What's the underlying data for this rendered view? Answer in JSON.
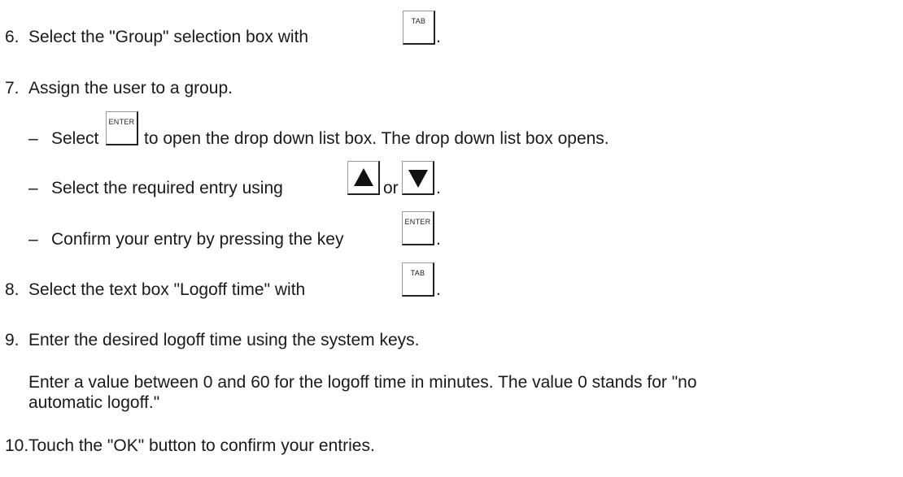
{
  "steps": [
    {
      "num": "6.",
      "before": "Select the \"Group\" selection box with",
      "key": "TAB",
      "after": "."
    },
    {
      "num": "7.",
      "text": "Assign the user to a group."
    },
    {
      "dash": "–",
      "before": "Select",
      "key": "ENTER",
      "after": "to open the drop down list box. The drop down list box opens."
    },
    {
      "dash": "–",
      "before": "Select the required entry using",
      "between": "or",
      "after": "."
    },
    {
      "dash": "–",
      "before": "Confirm your entry by pressing the key",
      "key": "ENTER",
      "after": "."
    },
    {
      "num": "8.",
      "before": "Select the text box \"Logoff time\" with",
      "key": "TAB",
      "after": "."
    },
    {
      "num": "9.",
      "text": "Enter the desired logoff time using the system keys."
    },
    {
      "para1": "Enter a value between 0 and 60 for the logoff time in minutes. The value 0 stands for \"no",
      "para2": "automatic logoff.\""
    },
    {
      "num": "10.",
      "text": "Touch the \"OK\" button to confirm your entries."
    }
  ],
  "icons": {
    "up": "arrow-up-key-icon",
    "down": "arrow-down-key-icon"
  }
}
